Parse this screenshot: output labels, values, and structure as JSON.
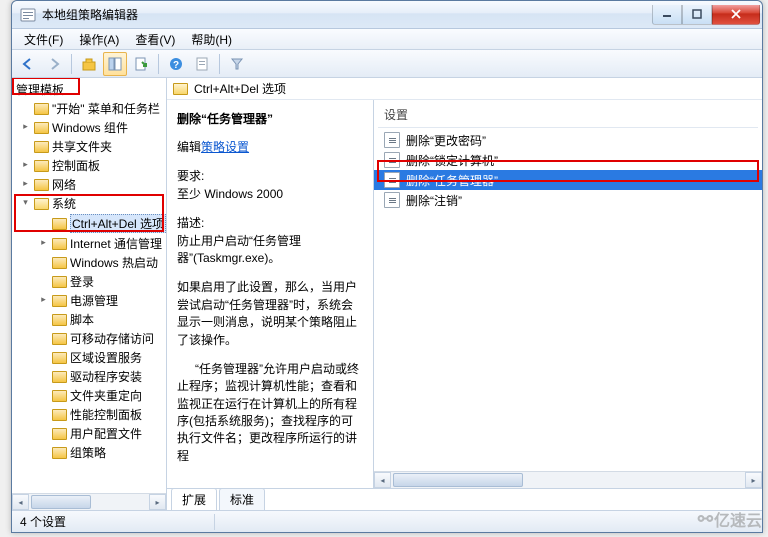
{
  "window": {
    "title": "本地组策略编辑器"
  },
  "menu": {
    "file": "文件(F)",
    "action": "操作(A)",
    "view": "查看(V)",
    "help": "帮助(H)"
  },
  "toolbar_icons": [
    "back",
    "forward",
    "up",
    "show-hide-tree",
    "export-list",
    "help",
    "properties",
    "filter"
  ],
  "tree": {
    "header": "管理模板",
    "items": [
      {
        "label": "\"开始\" 菜单和任务栏",
        "depth": 1
      },
      {
        "label": "Windows 组件",
        "depth": 1,
        "expandable": true
      },
      {
        "label": "共享文件夹",
        "depth": 1
      },
      {
        "label": "控制面板",
        "depth": 1,
        "expandable": true
      },
      {
        "label": "网络",
        "depth": 1,
        "expandable": true
      },
      {
        "label": "系统",
        "depth": 1,
        "open": true,
        "expandable": true
      },
      {
        "label": "Ctrl+Alt+Del 选项",
        "depth": 2,
        "selected": true
      },
      {
        "label": "Internet 通信管理",
        "depth": 2,
        "expandable": true
      },
      {
        "label": "Windows 热启动",
        "depth": 2
      },
      {
        "label": "登录",
        "depth": 2
      },
      {
        "label": "电源管理",
        "depth": 2,
        "expandable": true
      },
      {
        "label": "脚本",
        "depth": 2
      },
      {
        "label": "可移动存储访问",
        "depth": 2
      },
      {
        "label": "区域设置服务",
        "depth": 2
      },
      {
        "label": "驱动程序安装",
        "depth": 2
      },
      {
        "label": "文件夹重定向",
        "depth": 2
      },
      {
        "label": "性能控制面板",
        "depth": 2
      },
      {
        "label": "用户配置文件",
        "depth": 2
      },
      {
        "label": "组策略",
        "depth": 2
      }
    ]
  },
  "right_header": "Ctrl+Alt+Del 选项",
  "desc": {
    "title": "删除“任务管理器”",
    "edit_label": "编辑",
    "edit_link": "策略设置",
    "req_label": "要求:",
    "req_value": "至少 Windows 2000",
    "desc_label": "描述:",
    "p1": "防止用户启动“任务管理器”(Taskmgr.exe)。",
    "p2": "如果启用了此设置，那么，当用户尝试启动“任务管理器”时，系统会显示一则消息，说明某个策略阻止了该操作。",
    "p3": "“任务管理器”允许用户启动或终止程序；监视计算机性能；查看和监视正在运行在计算机上的所有程序(包括系统服务)；查找程序的可执行文件名；更改程序所运行的讲程"
  },
  "settings": {
    "header": "设置",
    "items": [
      "删除“更改密码”",
      "删除“锁定计算机”",
      "删除“任务管理器”",
      "删除“注销”"
    ],
    "selected_index": 2
  },
  "tabs": {
    "extended": "扩展",
    "standard": "标准"
  },
  "status": "4 个设置",
  "watermark": "亿速云"
}
